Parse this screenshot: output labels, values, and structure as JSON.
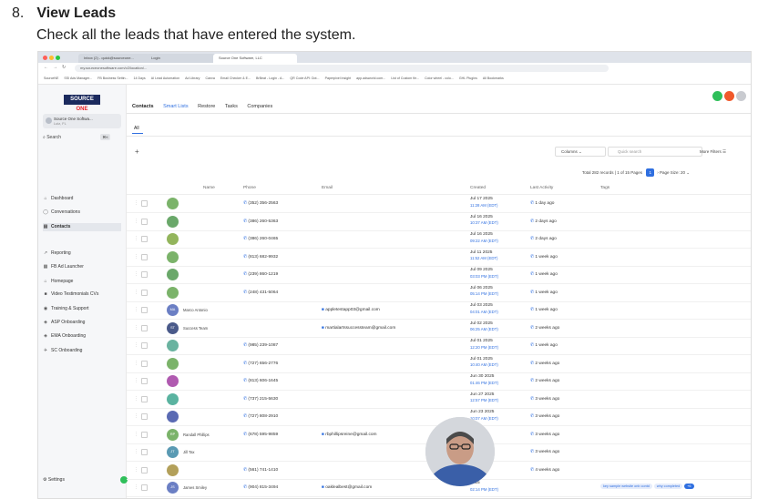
{
  "heading": {
    "number": "8.",
    "title": "View Leads",
    "subtitle": "Check all the leads that have entered the system."
  },
  "browser": {
    "tabs": [
      "Inbox (2) - quick@sourceone...",
      "Login",
      "Source One Software, LLC"
    ],
    "url": "my.sourceonesoftware.com/v2/location/...",
    "bookmarks": [
      "SourceNE",
      "SSI Ads Manager...",
      "FB Business Settin...",
      "14 Days",
      "AI Lead Automation",
      "Ad Library",
      "Canva",
      "Email Checker & E...",
      "BrBeat - Login - A...",
      "QR Code API: Dot...",
      "Paperpixel Insight",
      "app.adsworld.com...",
      "List of Custom fie...",
      "Color wheel - colo...",
      "GHL Plugins",
      "All Bookmarks"
    ]
  },
  "sidebar": {
    "logo": {
      "word1": "SOURCE",
      "word2": "ONE"
    },
    "account": {
      "title": "Source One Softwa...",
      "subtitle": "Lutz, FL"
    },
    "search_label": "Search",
    "search_shortcut": "⌘K",
    "items": [
      {
        "icon": "⌂",
        "label": "Dashboard"
      },
      {
        "icon": "◯",
        "label": "Conversations"
      },
      {
        "icon": "▤",
        "label": "Contacts"
      },
      {
        "icon": "↗",
        "label": "Reporting"
      },
      {
        "icon": "▦",
        "label": "FB Ad Launcher"
      },
      {
        "icon": "⌂",
        "label": "Homepage"
      },
      {
        "icon": "■",
        "label": "Video Testimonials CVs"
      },
      {
        "icon": "◉",
        "label": "Training & Support"
      },
      {
        "icon": "◈",
        "label": "ASP Onboarding"
      },
      {
        "icon": "◈",
        "label": "EMA Onboarding"
      },
      {
        "icon": "✈",
        "label": "SC Onboarding"
      }
    ],
    "settings_label": "Settings"
  },
  "main": {
    "tabs": [
      "Contacts",
      "Smart Lists",
      "Restore",
      "Tasks",
      "Companies"
    ],
    "subtab": "All",
    "columns_label": "Columns",
    "quick_search_placeholder": "Quick search",
    "more_filters": "More Filters",
    "pager": {
      "total": "Total 282 records | 1 of 15 Pages",
      "page": "1",
      "page_size": "Page Size: 20"
    },
    "headers": [
      "Name",
      "Phone",
      "Email",
      "Created",
      "Last Activity",
      "Tags"
    ],
    "rows": [
      {
        "initials": "",
        "name": "",
        "phone": "(352) 356-2563",
        "email": "",
        "date": "Jul 17 2025",
        "time": "11:28 AM (EDT)",
        "activity": "1 day ago",
        "color": "#7bb36a"
      },
      {
        "initials": "",
        "name": "",
        "phone": "(386) 260-5363",
        "email": "",
        "date": "Jul 16 2025",
        "time": "10:37 AM (EDT)",
        "activity": "2 days ago",
        "color": "#6aa86a"
      },
      {
        "initials": "",
        "name": "",
        "phone": "(386) 260-0465",
        "email": "",
        "date": "Jul 16 2025",
        "time": "09:22 AM (EDT)",
        "activity": "2 days ago",
        "color": "#93b55c"
      },
      {
        "initials": "",
        "name": "",
        "phone": "(813) 682-9932",
        "email": "",
        "date": "Jul 11 2025",
        "time": "11:52 AM (EDT)",
        "activity": "1 week ago",
        "color": "#7bb36a"
      },
      {
        "initials": "",
        "name": "",
        "phone": "(239) 860-1219",
        "email": "",
        "date": "Jul 09 2025",
        "time": "03:03 PM (EDT)",
        "activity": "1 week ago",
        "color": "#6aa86a"
      },
      {
        "initials": "",
        "name": "",
        "phone": "(248) 431-5064",
        "email": "",
        "date": "Jul 06 2025",
        "time": "05:14 PM (EDT)",
        "activity": "1 week ago",
        "color": "#7bb36a"
      },
      {
        "initials": "MA",
        "name": "Marco Antonio",
        "phone": "",
        "email": "appletestapp03@gmail.com",
        "date": "Jul 03 2025",
        "time": "04:01 AM (EDT)",
        "activity": "1 week ago",
        "color": "#6b7fc4"
      },
      {
        "initials": "ST",
        "name": "Success Team",
        "phone": "",
        "email": "martialartssuccessteam@gmail.com",
        "date": "Jul 02 2025",
        "time": "06:25 AM (EDT)",
        "activity": "2 weeks ago",
        "color": "#4a5a8a"
      },
      {
        "initials": "",
        "name": "",
        "phone": "(985) 239-1087",
        "email": "",
        "date": "Jul 01 2025",
        "time": "12:20 PM (EDT)",
        "activity": "1 week ago",
        "color": "#6ab3a0"
      },
      {
        "initials": "",
        "name": "",
        "phone": "(727) 656-2776",
        "email": "",
        "date": "Jul 01 2025",
        "time": "10:40 AM (EDT)",
        "activity": "2 weeks ago",
        "color": "#7bb36a"
      },
      {
        "initials": "",
        "name": "",
        "phone": "(813) 606-1645",
        "email": "",
        "date": "Jun 30 2025",
        "time": "01:46 PM (EDT)",
        "activity": "2 weeks ago",
        "color": "#b05ab0"
      },
      {
        "initials": "",
        "name": "",
        "phone": "(737) 215-5630",
        "email": "",
        "date": "Jun 27 2025",
        "time": "12:57 PM (EDT)",
        "activity": "3 weeks ago",
        "color": "#5ab3a0"
      },
      {
        "initials": "",
        "name": "",
        "phone": "(727) 808-2910",
        "email": "",
        "date": "Jun 23 2025",
        "time": "10:07 AM (EDT)",
        "activity": "3 weeks ago",
        "color": "#5a6ab3"
      },
      {
        "initials": "RP",
        "name": "Randall Phillips",
        "phone": "(678) 595-9859",
        "email": "rbphillipsreine@gmail.com",
        "date": "2025",
        "time": "(EDT)",
        "activity": "3 weeks ago",
        "color": "#7bb36a"
      },
      {
        "initials": "JT",
        "name": "Jill Tax",
        "phone": "",
        "email": "",
        "date": "25",
        "time": "(EDT)",
        "activity": "3 weeks ago",
        "color": "#5a9ab3"
      },
      {
        "initials": "",
        "name": "",
        "phone": "(561) 741-1410",
        "email": "",
        "date": "25",
        "time": "(EDT)",
        "activity": "4 weeks ago",
        "color": "#b3a05a"
      },
      {
        "initials": "JS",
        "name": "James Smiley",
        "phone": "(904) 815-3494",
        "email": "oaklealbest@gmail.com",
        "date": "2025",
        "time": "02:14 PM (EDT)",
        "activity": "",
        "color": "#6b7fc4",
        "tags": [
          "key sample website onb contd",
          "why completed"
        ],
        "tag_more": "+6"
      }
    ]
  },
  "colors": {
    "accent": "#2f6fe0",
    "logo_bg": "#1b2a5e",
    "logo_red": "#e8232a"
  }
}
